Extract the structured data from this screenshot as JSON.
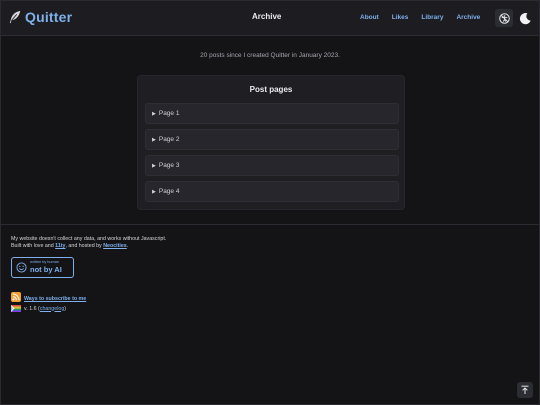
{
  "header": {
    "logo_text": "Quitter",
    "title": "Archive",
    "nav": [
      "About",
      "Likes",
      "Library",
      "Archive"
    ],
    "logo_icon": "feather-icon",
    "accessibility_icon": "accessibility-icon",
    "theme_icon": "moon-icon"
  },
  "main": {
    "intro": "20 posts since I created Quitter in January 2023.",
    "card_title": "Post pages",
    "pages": [
      "Page 1",
      "Page 2",
      "Page 3",
      "Page 4"
    ]
  },
  "footer": {
    "line1": "My website doesn't collect any data, and works without Javascript.",
    "line2_prefix": "Built with love and ",
    "line2_link1": "11ty",
    "line2_mid": ", and hosted by ",
    "line2_link2": "Neocities",
    "line2_suffix": ".",
    "badge_small": "written by human",
    "badge_big": "not by AI",
    "rss_link": "Ways to subscribe to me",
    "version_text": "v. 1.6 (",
    "version_link": "changelog",
    "version_suffix": ")"
  },
  "colors": {
    "background": "#141417",
    "accent": "#7fb0ea",
    "card": "#1e1e23",
    "rss": "#f0a033"
  }
}
